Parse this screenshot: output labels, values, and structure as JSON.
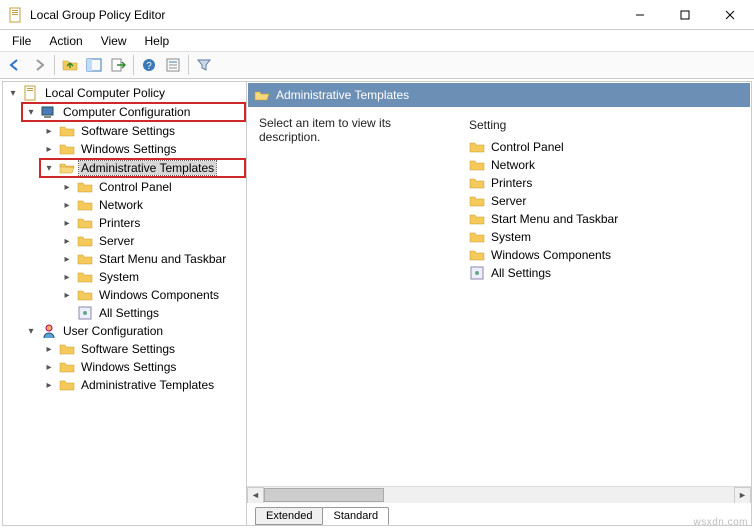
{
  "window": {
    "title": "Local Group Policy Editor"
  },
  "menubar": {
    "file": "File",
    "action": "Action",
    "view": "View",
    "help": "Help"
  },
  "toolbar_icons": [
    "back",
    "forward",
    "up",
    "pane",
    "export",
    "refresh",
    "help",
    "prop",
    "filter"
  ],
  "tree": {
    "root": "Local Computer Policy",
    "computer": {
      "label": "Computer Configuration",
      "children": {
        "software": "Software Settings",
        "windows": "Windows Settings",
        "admin": {
          "label": "Administrative Templates",
          "children": {
            "controlpanel": "Control Panel",
            "network": "Network",
            "printers": "Printers",
            "server": "Server",
            "startmenu": "Start Menu and Taskbar",
            "system": "System",
            "wincomp": "Windows Components",
            "allsettings": "All Settings"
          }
        }
      }
    },
    "user": {
      "label": "User Configuration",
      "children": {
        "software": "Software Settings",
        "windows": "Windows Settings",
        "admin": "Administrative Templates"
      }
    }
  },
  "right": {
    "path_title": "Administrative Templates",
    "description": "Select an item to view its description.",
    "list_header": "Setting",
    "items": [
      "Control Panel",
      "Network",
      "Printers",
      "Server",
      "Start Menu and Taskbar",
      "System",
      "Windows Components",
      "All Settings"
    ]
  },
  "tabs": {
    "extended": "Extended",
    "standard": "Standard"
  },
  "watermark": "wsxdn.com"
}
